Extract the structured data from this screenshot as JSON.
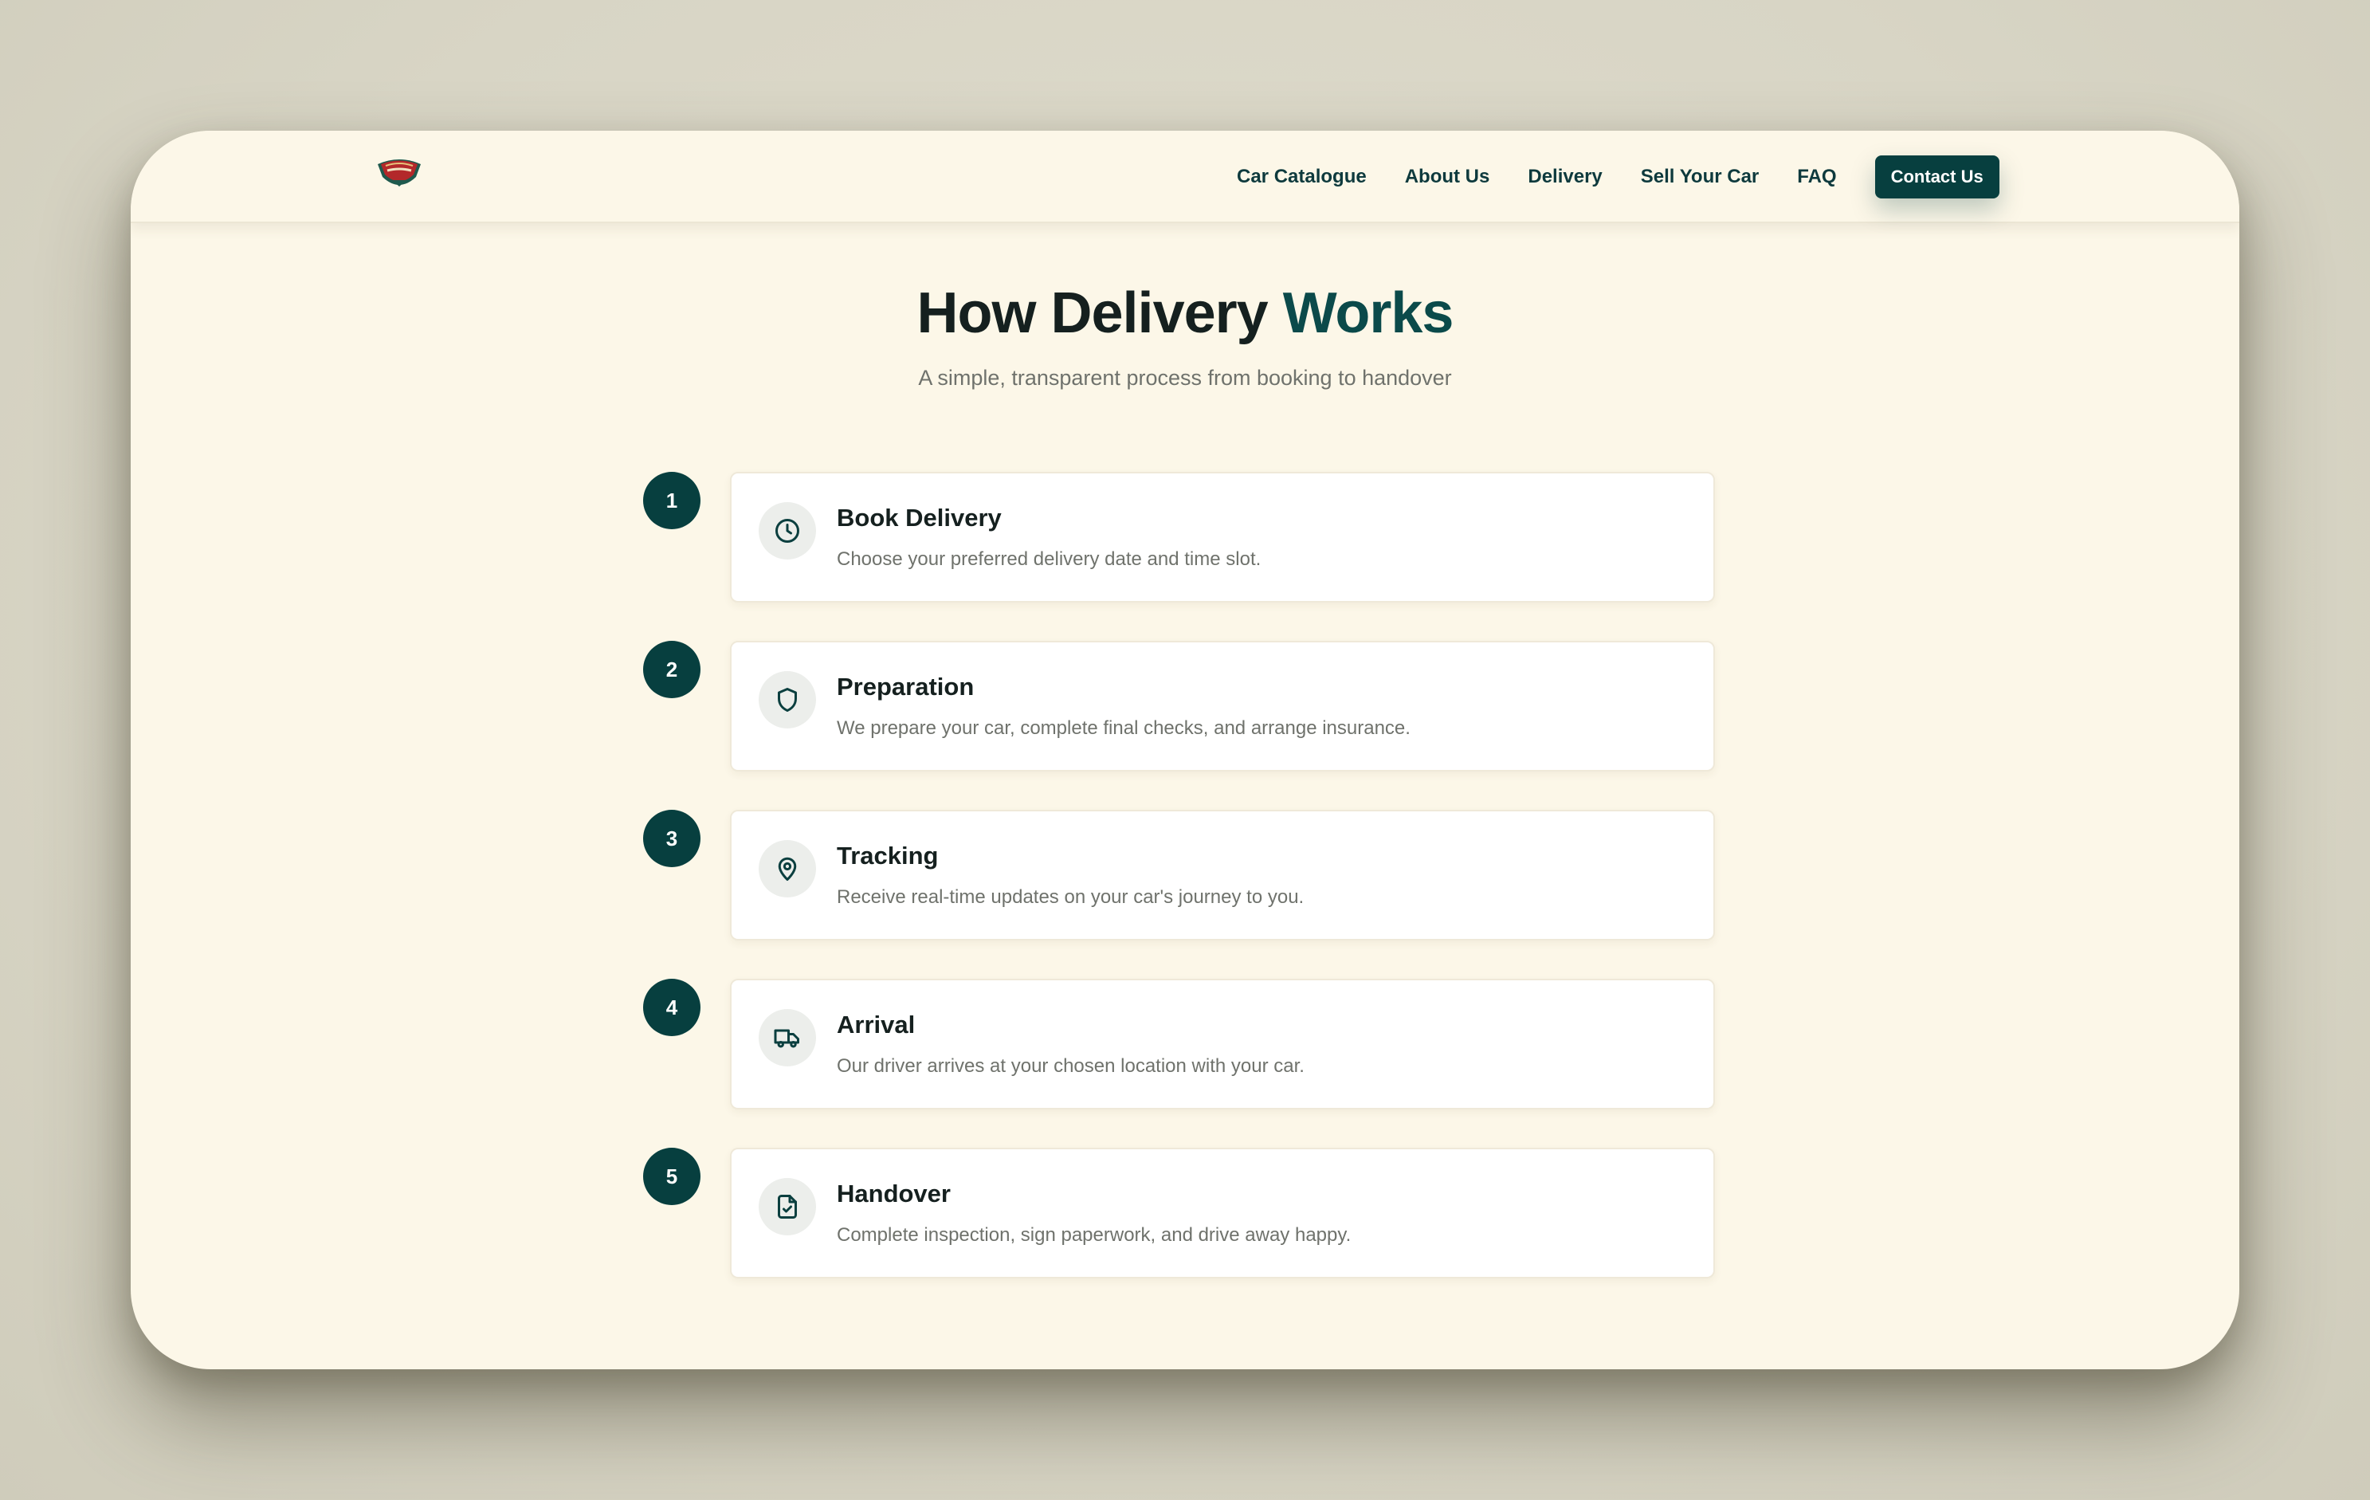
{
  "colors": {
    "brand": "#073f3f",
    "background": "#fcf7e8",
    "text": "#15201f",
    "muted": "#6f726c"
  },
  "nav": {
    "logo_icon": "brand-badge-icon",
    "links": [
      "Car Catalogue",
      "About Us",
      "Delivery",
      "Sell Your Car",
      "FAQ"
    ],
    "cta": "Contact Us"
  },
  "hero": {
    "title_main": "How Delivery ",
    "title_accent": "Works",
    "subtitle": "A simple, transparent process from booking to handover"
  },
  "steps": [
    {
      "number": "1",
      "icon": "clock-icon",
      "title": "Book Delivery",
      "description": "Choose your preferred delivery date and time slot."
    },
    {
      "number": "2",
      "icon": "shield-icon",
      "title": "Preparation",
      "description": "We prepare your car, complete final checks, and arrange insurance."
    },
    {
      "number": "3",
      "icon": "map-pin-icon",
      "title": "Tracking",
      "description": "Receive real-time updates on your car's journey to you."
    },
    {
      "number": "4",
      "icon": "truck-icon",
      "title": "Arrival",
      "description": "Our driver arrives at your chosen location with your car."
    },
    {
      "number": "5",
      "icon": "file-check-icon",
      "title": "Handover",
      "description": "Complete inspection, sign paperwork, and drive away happy."
    }
  ]
}
